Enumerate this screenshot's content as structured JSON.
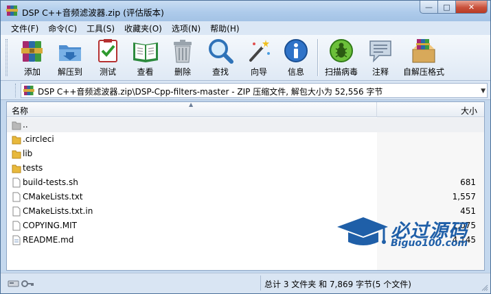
{
  "title": "DSP C++音频滤波器.zip (评估版本)",
  "window_buttons": {
    "minimize": "—",
    "maximize": "□",
    "close": "✕"
  },
  "menu": [
    "文件(F)",
    "命令(C)",
    "工具(S)",
    "收藏夹(O)",
    "选项(N)",
    "帮助(H)"
  ],
  "toolbar": [
    {
      "label": "添加",
      "icon": "add-archive-icon"
    },
    {
      "label": "解压到",
      "icon": "extract-to-icon"
    },
    {
      "label": "测试",
      "icon": "test-icon"
    },
    {
      "label": "查看",
      "icon": "view-icon"
    },
    {
      "label": "删除",
      "icon": "delete-icon"
    },
    {
      "label": "查找",
      "icon": "find-icon"
    },
    {
      "label": "向导",
      "icon": "wizard-icon"
    },
    {
      "label": "信息",
      "icon": "info-icon"
    },
    {
      "label": "扫描病毒",
      "icon": "virus-scan-icon"
    },
    {
      "label": "注释",
      "icon": "comment-icon"
    },
    {
      "label": "自解压格式",
      "icon": "sfx-icon"
    }
  ],
  "address": "DSP C++音频滤波器.zip\\DSP-Cpp-filters-master - ZIP 压缩文件, 解包大小为 52,556 字节",
  "columns": {
    "name": "名称",
    "size": "大小"
  },
  "files": [
    {
      "name": "..",
      "size": "",
      "type": "up"
    },
    {
      "name": ".circleci",
      "size": "",
      "type": "folder"
    },
    {
      "name": "lib",
      "size": "",
      "type": "folder"
    },
    {
      "name": "tests",
      "size": "",
      "type": "folder"
    },
    {
      "name": "build-tests.sh",
      "size": "681",
      "type": "file"
    },
    {
      "name": "CMakeLists.txt",
      "size": "1,557",
      "type": "file"
    },
    {
      "name": "CMakeLists.txt.in",
      "size": "451",
      "type": "file"
    },
    {
      "name": "COPYING.MIT",
      "size": "1,075",
      "type": "file"
    },
    {
      "name": "README.md",
      "size": "4,145",
      "type": "file"
    }
  ],
  "status": "总计 3 文件夹 和 7,869 字节(5 个文件)",
  "watermark": {
    "main": "必过源码",
    "sub": "Biguo100.com"
  },
  "colors": {
    "accent": "#1f5fa8",
    "folder": "#e8b93c",
    "frame": "#c4d8ee"
  }
}
